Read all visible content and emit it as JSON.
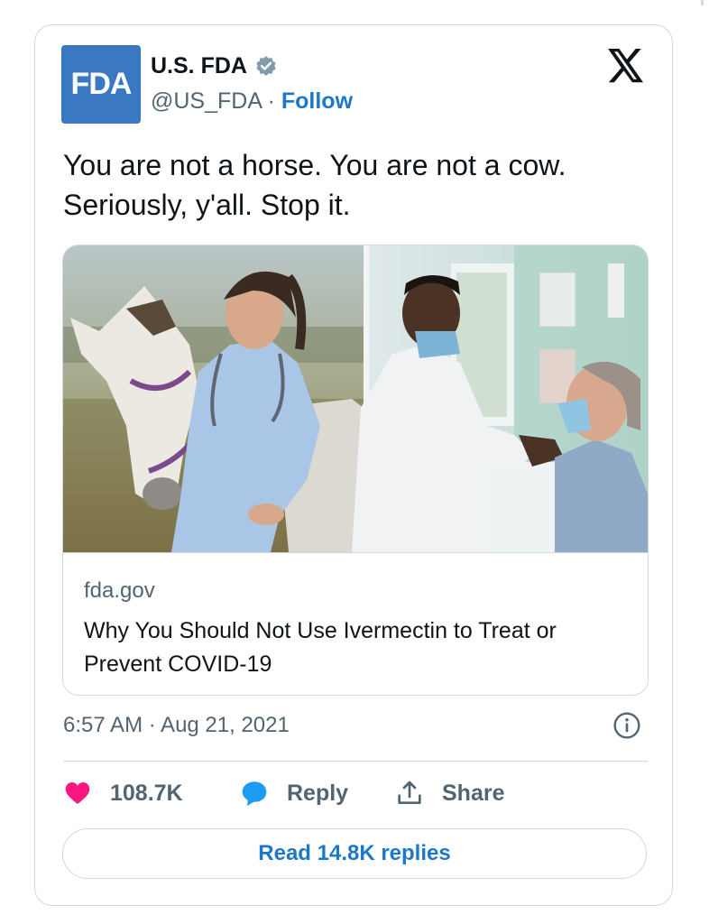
{
  "account": {
    "logo_text": "FDA",
    "display_name": "U.S. FDA",
    "handle": "@US_FDA",
    "separator": " · ",
    "follow_label": "Follow"
  },
  "tweet": {
    "text_line1": "You are not a horse. You are not a cow.",
    "text_line2": "Seriously, y'all. Stop it."
  },
  "link_card": {
    "domain": "fda.gov",
    "title": "Why You Should Not Use Ivermectin to Treat or Prevent COVID-19"
  },
  "meta": {
    "timestamp": "6:57 AM · Aug 21, 2021"
  },
  "actions": {
    "like_count": "108.7K",
    "reply_label": "Reply",
    "share_label": "Share",
    "read_replies_label": "Read 14.8K replies"
  },
  "colors": {
    "brand": "#3a78c2",
    "link": "#1d78c9",
    "like": "#f91880",
    "reply": "#1d9bf0",
    "muted": "#536471"
  },
  "icons": [
    "verified-badge-icon",
    "x-logo-icon",
    "info-icon",
    "heart-icon",
    "reply-bubble-icon",
    "share-icon"
  ]
}
